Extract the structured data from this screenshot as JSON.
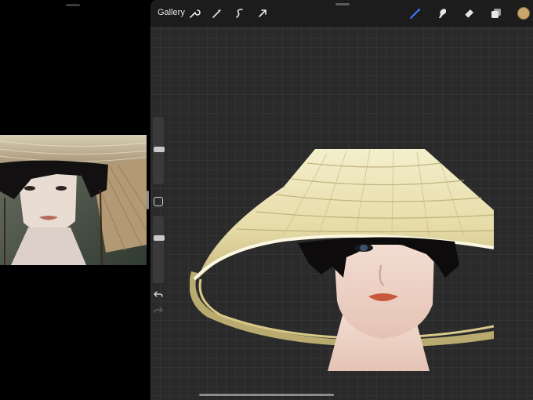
{
  "toolbar": {
    "gallery_label": "Gallery",
    "left_tools": [
      "wrench-icon",
      "magic-wand-icon",
      "selection-icon",
      "transform-arrow-icon"
    ],
    "right_tools": [
      "brush-icon",
      "smudge-icon",
      "eraser-icon",
      "layers-icon"
    ],
    "active_tool": "brush-icon",
    "active_tool_color": "#3a7bff",
    "current_color": "#c8a66a"
  },
  "sidebar": {
    "brush_size": 0.26,
    "brush_opacity": 0.85,
    "controls": [
      "modify-square-icon",
      "undo-icon",
      "redo-icon"
    ]
  },
  "colors": {
    "canvas_background": "#2a2a2a",
    "hat": "#ece6bb",
    "hair": "#0d0b0b",
    "skin": "#f0d6c8"
  }
}
